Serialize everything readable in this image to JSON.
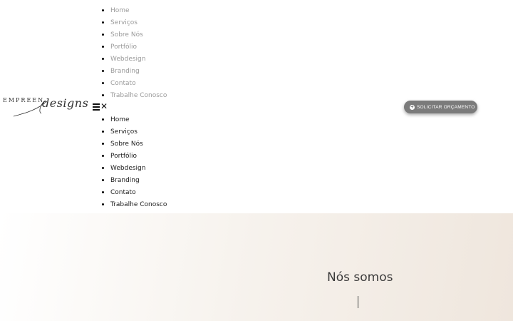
{
  "nav_top": [
    "Home",
    "Serviços",
    "Sobre Nós",
    "Portfólio",
    "Webdesign",
    "Branding",
    "Contato",
    "Trabalhe Conosco"
  ],
  "nav_bottom": [
    "Home",
    "Serviços",
    "Sobre Nós",
    "Portfólio",
    "Webdesign",
    "Branding",
    "Contato",
    "Trabalhe Conosco"
  ],
  "logo": {
    "top_text": "EMPREEN",
    "script_text": "designs"
  },
  "cta": {
    "label": "SOLICITAR ORÇAMENTO",
    "icon": "plus-circle-icon"
  },
  "hero": {
    "title": "Nós somos"
  },
  "menu": {
    "hamburger_icon": "hamburger-icon",
    "close_icon": "close-icon",
    "close_glyph": "✕"
  }
}
